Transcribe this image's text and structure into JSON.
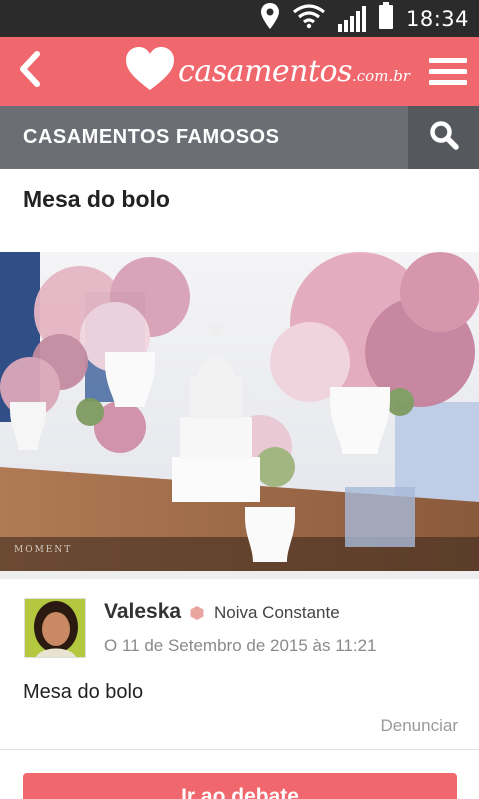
{
  "status_bar": {
    "time": "18:34",
    "icons": [
      "location-pin-icon",
      "wifi-icon",
      "signal-icon",
      "battery-icon"
    ]
  },
  "app_bar": {
    "logo_text": "casamentos",
    "logo_suffix": ".com.br",
    "back_icon": "chevron-left-icon",
    "menu_icon": "hamburger-menu-icon",
    "background_color": "#f0686e"
  },
  "section": {
    "title": "CASAMENTOS FAMOSOS",
    "search_icon": "search-icon",
    "background_color": "#6b6e74"
  },
  "post": {
    "title": "Mesa do bolo",
    "image_watermark": "MOMENT",
    "author": {
      "name": "Valeska",
      "role": "Noiva Constante",
      "badge_color": "#e9a5a0"
    },
    "date": "O 11 de Setembro de 2015 às 11:21",
    "body": "Mesa do bolo",
    "report_label": "Denunciar"
  },
  "cta": {
    "label": "Ir ao debate"
  }
}
